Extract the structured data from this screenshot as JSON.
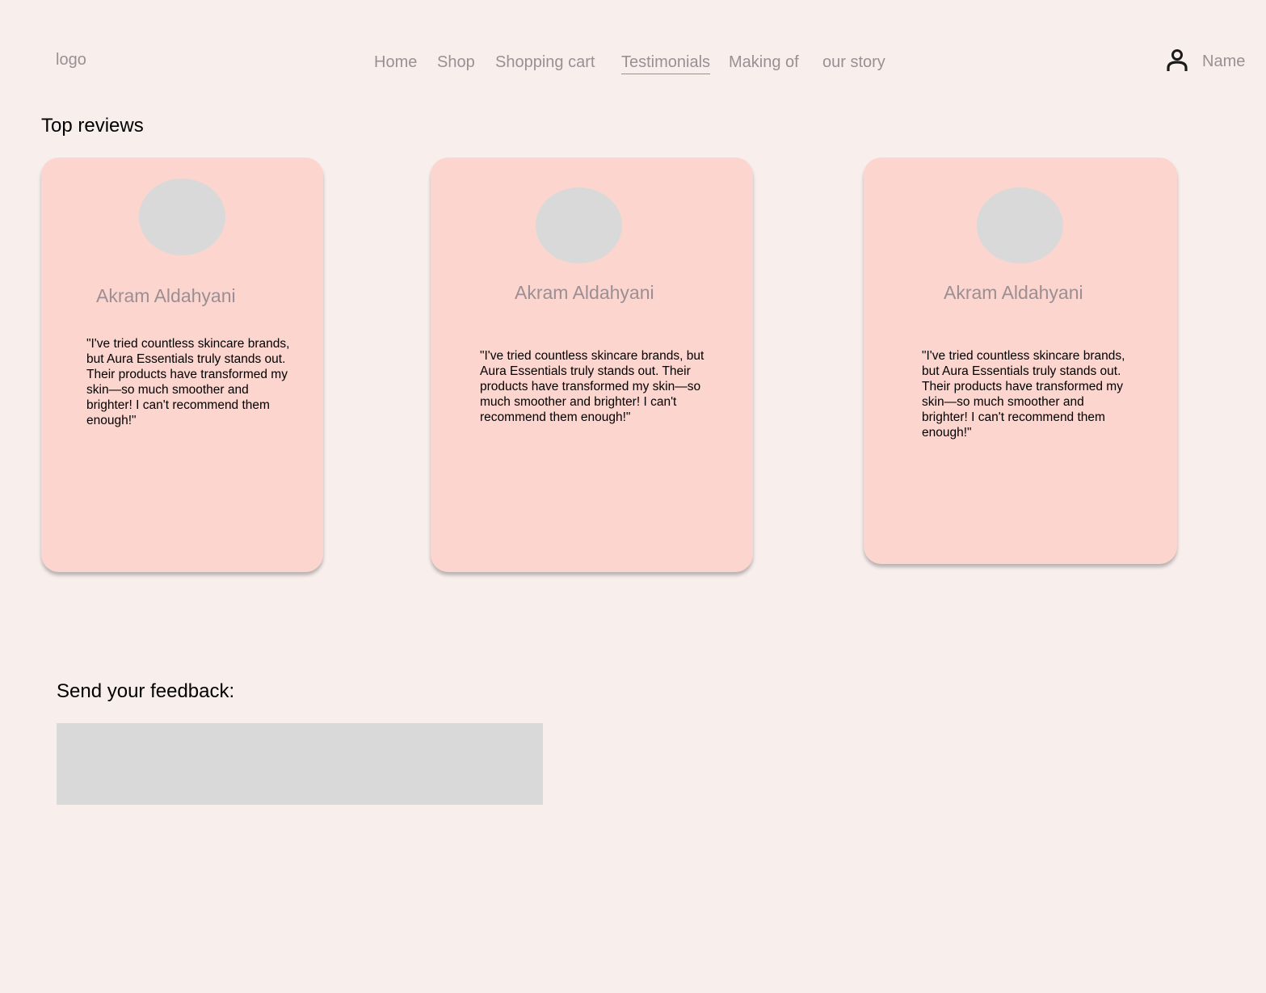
{
  "header": {
    "logo": "logo",
    "nav": [
      {
        "label": "Home"
      },
      {
        "label": "Shop"
      },
      {
        "label": "Shopping cart"
      },
      {
        "label": "Testimonials"
      },
      {
        "label": "Making of"
      },
      {
        "label": "our story"
      }
    ],
    "active_nav": "Testimonials",
    "user": {
      "icon": "user-icon",
      "name": "Name"
    }
  },
  "reviews": {
    "title": "Top reviews",
    "items": [
      {
        "name": "Akram Aldahyani",
        "text": "\"I've tried countless skincare brands, but Aura Essentials truly stands out. Their products have transformed my skin—so much smoother and brighter! I can't recommend them enough!\""
      },
      {
        "name": "Akram Aldahyani",
        "text": "\"I've tried countless skincare brands, but Aura Essentials truly stands out. Their products have transformed my skin—so much smoother and brighter! I can't recommend them enough!\""
      },
      {
        "name": "Akram Aldahyani",
        "text": "\"I've tried countless skincare brands, but Aura Essentials truly stands out. Their products have transformed my skin—so much smoother and brighter! I can't recommend them enough!\""
      }
    ]
  },
  "feedback": {
    "label": "Send your feedback:",
    "value": ""
  },
  "colors": {
    "background": "#f8eeec",
    "card": "#fcd5ce",
    "muted_text": "#9b8f94",
    "placeholder_gray": "#d9d9d9"
  }
}
